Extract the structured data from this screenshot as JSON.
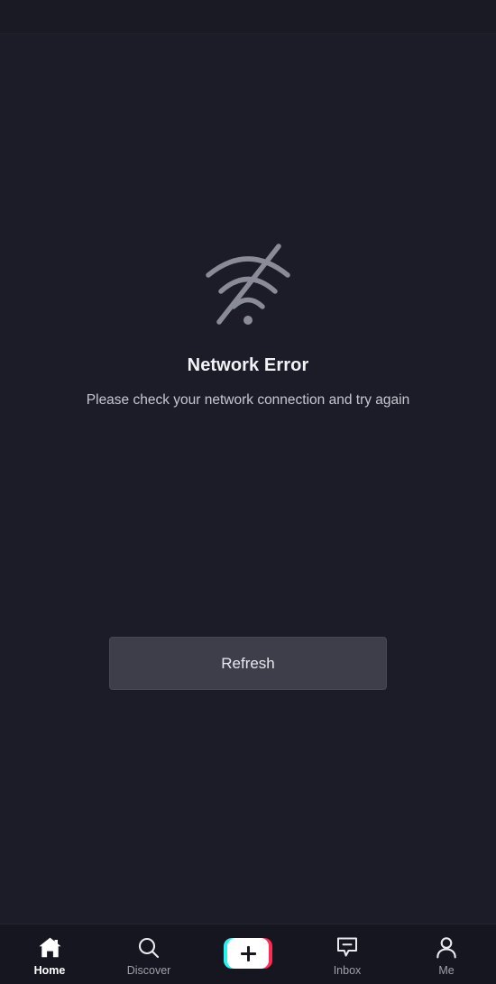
{
  "screen": {
    "background_color": "#1b1c27",
    "top_strip_color": "#191a24"
  },
  "error_state": {
    "icon": "wifi-off-icon",
    "icon_color": "#8a8b98",
    "title": "Network Error",
    "subtitle": "Please check your network connection and try again",
    "action": {
      "label": "Refresh",
      "background_color": "#3e3e4a",
      "text_color": "#e6e7ee"
    }
  },
  "bottom_nav": {
    "background_color": "#15161f",
    "active_color": "#ffffff",
    "inactive_color": "#9fa0ad",
    "items": [
      {
        "id": "home",
        "label": "Home",
        "icon": "home-icon",
        "active": true
      },
      {
        "id": "discover",
        "label": "Discover",
        "icon": "search-icon",
        "active": false
      },
      {
        "id": "create",
        "label": "",
        "icon": "plus-create-button",
        "active": false
      },
      {
        "id": "inbox",
        "label": "Inbox",
        "icon": "message-icon",
        "active": false
      },
      {
        "id": "me",
        "label": "Me",
        "icon": "person-icon",
        "active": false
      }
    ],
    "create_button": {
      "left_accent_color": "#25f4ee",
      "right_accent_color": "#fe2c55",
      "face_color": "#ffffff",
      "glyph": "plus"
    }
  }
}
